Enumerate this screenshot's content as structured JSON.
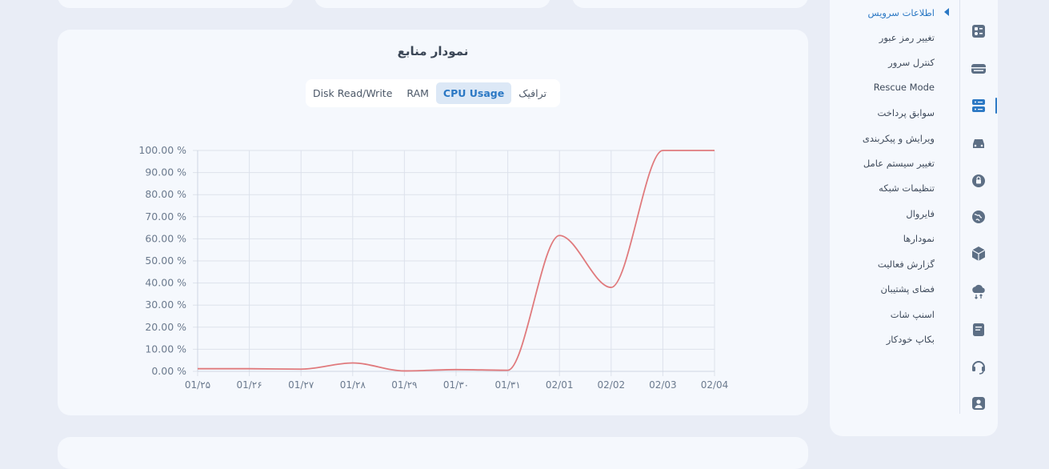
{
  "chart_panel": {
    "title": "نمودار منابع",
    "tabs": [
      {
        "label": "ترافیک",
        "active": false
      },
      {
        "label": "CPU Usage",
        "active": true
      },
      {
        "label": "RAM",
        "active": false
      },
      {
        "label": "Disk Read/Write",
        "active": false
      }
    ]
  },
  "side_menu": {
    "items": [
      {
        "label": "اطلاعات سرویس",
        "active": true
      },
      {
        "label": "تغییر رمز عبور"
      },
      {
        "label": "کنترل سرور"
      },
      {
        "label": "Rescue Mode"
      },
      {
        "label": "سوابق پرداخت"
      },
      {
        "label": "ویرایش و پیکربندی"
      },
      {
        "label": "تغییر سیستم عامل"
      },
      {
        "label": "تنظیمات شبکه"
      },
      {
        "label": "فایروال"
      },
      {
        "label": "نمودارها"
      },
      {
        "label": "گزارش فعالیت"
      },
      {
        "label": "فضای پشتیبان"
      },
      {
        "label": "اسنپ شات"
      },
      {
        "label": "بکاپ خودکار"
      }
    ]
  },
  "icon_rail": [
    "dashboard-icon",
    "server-icon",
    "servers-icon",
    "car-icon",
    "lock-icon",
    "globe-icon",
    "box-icon",
    "cloud-sync-icon",
    "document-icon",
    "headset-icon",
    "user-icon"
  ],
  "colors": {
    "accent": "#2b78c4",
    "line": "#e07a7d",
    "grid": "#dde2ec",
    "background": "#e9edf6",
    "card": "#f5f8fd"
  },
  "chart_data": {
    "type": "line",
    "x": [
      "01/۲۵",
      "01/۲۶",
      "01/۲۷",
      "01/۲۸",
      "01/۲۹",
      "01/۳۰",
      "01/۳۱",
      "02/01",
      "02/02",
      "02/03",
      "02/04"
    ],
    "x_tick_labels": [
      "01/۲۵",
      "01/۲۶",
      "01/۲۷",
      "01/۲۸",
      "01/۲۹",
      "01/۳۰",
      "01/۳۱",
      "02/01",
      "02/02",
      "02/03",
      "02/04"
    ],
    "series": [
      {
        "name": "",
        "color": "#e07a7d",
        "values": [
          1.2,
          1.2,
          1.0,
          3.8,
          0.2,
          0.8,
          0.5,
          61.5,
          38.0,
          100.0,
          100.0
        ]
      }
    ],
    "y_tick_labels": [
      "0.00 %",
      "10.00 %",
      "20.00 %",
      "30.00 %",
      "40.00 %",
      "50.00 %",
      "60.00 %",
      "70.00 %",
      "80.00 %",
      "90.00 %",
      "100.00 %"
    ],
    "ylim": [
      0,
      100
    ],
    "grid": true,
    "legend": "none"
  }
}
